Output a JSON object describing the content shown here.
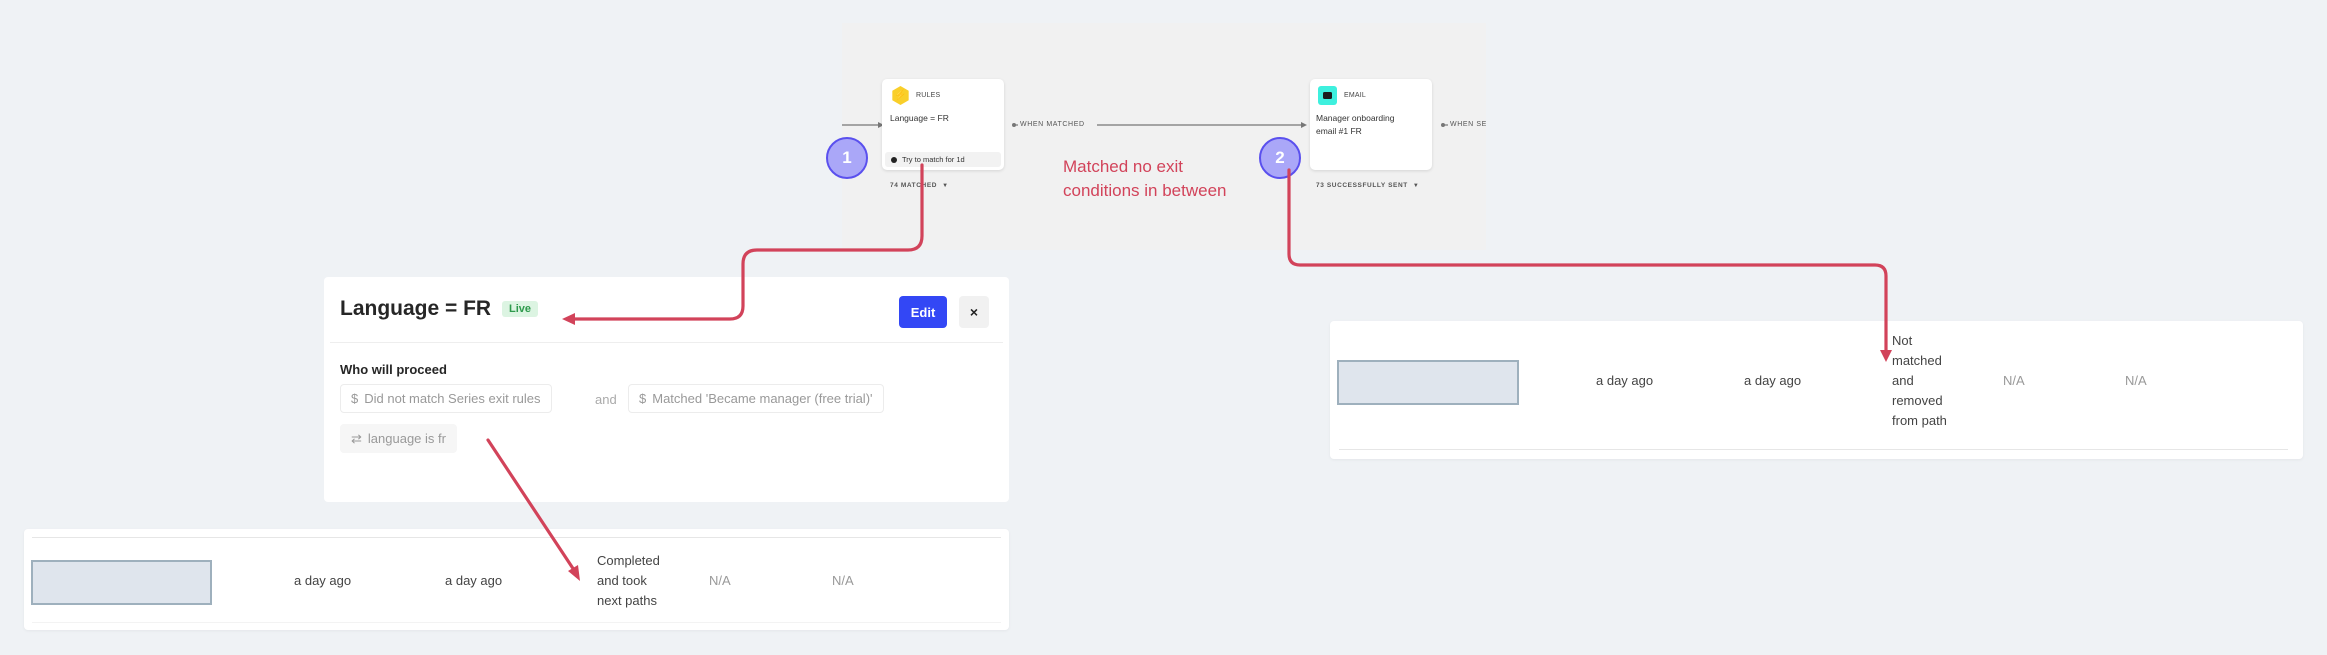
{
  "canvas": {
    "rules_node": {
      "type_label": "RULES",
      "title": "Language = FR",
      "try_label": "Try to match for 1d",
      "count_label": "74 MATCHED"
    },
    "edge_label_1": "WHEN MATCHED",
    "email_node": {
      "type_label": "EMAIL",
      "title": "Manager onboarding email #1 FR",
      "count_label": "73 SUCCESSFULLY SENT"
    },
    "edge_label_2": "WHEN SEN",
    "step_markers": [
      "1",
      "2"
    ]
  },
  "annotation": {
    "line1": "Matched no exit",
    "line2": "conditions in between",
    "color": "#d2435a"
  },
  "panel": {
    "title": "Language = FR",
    "status_badge": "Live",
    "edit_label": "Edit",
    "close_label": "×",
    "section_label": "Who will proceed",
    "conditions": [
      {
        "icon": "series-icon",
        "text": "Did not match Series exit rules"
      },
      {
        "icon": "series-icon",
        "text": "Matched 'Became manager (free trial)'"
      },
      {
        "icon": "swap-icon",
        "text": "language is fr"
      }
    ],
    "and_label": "and"
  },
  "table_left": {
    "row": {
      "col1": "a day ago",
      "col2": "a day ago",
      "status": [
        "Completed",
        "and took",
        "next paths"
      ],
      "col4": "N/A",
      "col5": "N/A"
    }
  },
  "table_right": {
    "row": {
      "col1": "a day ago",
      "col2": "a day ago",
      "status": [
        "Not",
        "matched",
        "and",
        "removed",
        "from path"
      ],
      "col4": "N/A",
      "col5": "N/A"
    }
  },
  "colors": {
    "accent": "#3347f5",
    "live_green": "#2e9a4c",
    "step_fill": "#aaa7f8",
    "step_border": "#5a50ee",
    "rules_yellow": "#f9cf2a",
    "email_teal": "#3ef0de"
  }
}
